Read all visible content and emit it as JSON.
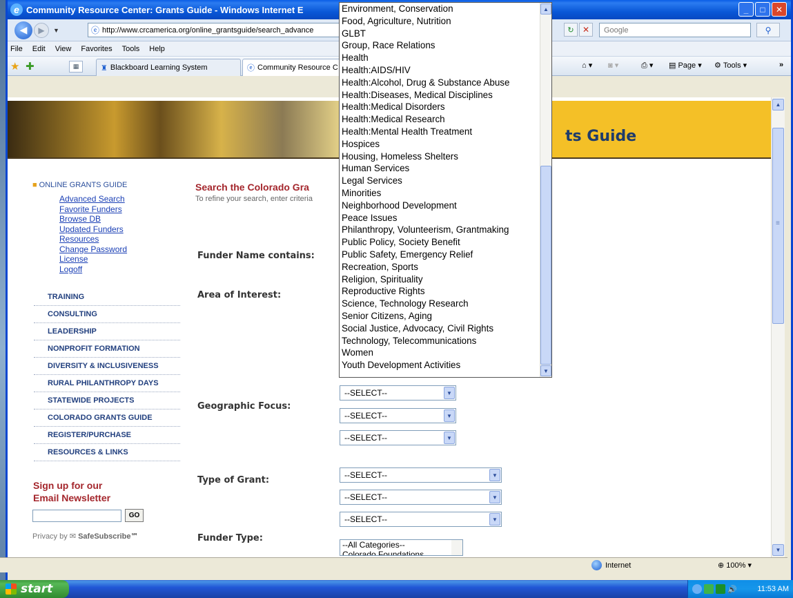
{
  "window": {
    "title": "Community Resource Center: Grants Guide - Windows Internet E",
    "minimize": "_",
    "maximize": "□",
    "close": "✕"
  },
  "address_bar": {
    "url": "http://www.crcamerica.org/online_grantsguide/search_advance",
    "search_placeholder": "Google"
  },
  "menu": [
    "File",
    "Edit",
    "View",
    "Favorites",
    "Tools",
    "Help"
  ],
  "tabs": [
    {
      "label": "Blackboard Learning System"
    },
    {
      "label": "Community Resource C"
    }
  ],
  "command_bar": {
    "page": "Page",
    "tools": "Tools"
  },
  "banner": {
    "title": "ts Guide"
  },
  "sidebar": {
    "heading": "ONLINE GRANTS GUIDE",
    "links": [
      "Advanced Search",
      "Favorite Funders",
      "Browse DB",
      "Updated Funders",
      "Resources",
      "Change Password",
      "License",
      "Logoff"
    ],
    "menu": [
      "TRAINING",
      "CONSULTING",
      "LEADERSHIP",
      "NONPROFIT FORMATION",
      "DIVERSITY & INCLUSIVENESS",
      "RURAL PHILANTHROPY DAYS",
      "STATEWIDE PROJECTS",
      "COLORADO GRANTS GUIDE",
      "REGISTER/PURCHASE",
      "RESOURCES & LINKS"
    ],
    "newsletter_line1": "Sign up for our",
    "newsletter_line2": "Email Newsletter",
    "go": "GO",
    "privacy_by": "Privacy by",
    "safesubscribe": "SafeSubscribe℠"
  },
  "search": {
    "title": "Search the Colorado Gra",
    "subtitle": "To refine your search, enter criteria",
    "labels": {
      "funder_name": "Funder Name contains:",
      "area": "Area of Interest:",
      "geo": "Geographic Focus:",
      "grant_type": "Type of Grant:",
      "funder_type": "Funder Type:"
    },
    "select_default": "--SELECT--",
    "funder_type_options": [
      "--All Categories--",
      "Colorado Foundations"
    ]
  },
  "area_dropdown_options": [
    "Environment, Conservation",
    "Food, Agriculture, Nutrition",
    "GLBT",
    "Group, Race Relations",
    "Health",
    "Health:AIDS/HIV",
    "Health:Alcohol, Drug & Substance Abuse",
    "Health:Diseases, Medical Disciplines",
    "Health:Medical Disorders",
    "Health:Medical Research",
    "Health:Mental Health Treatment",
    "Hospices",
    "Housing, Homeless Shelters",
    "Human Services",
    "Legal Services",
    "Minorities",
    "Neighborhood Development",
    "Peace Issues",
    "Philanthropy, Volunteerism, Grantmaking",
    "Public Policy, Society Benefit",
    "Public Safety, Emergency Relief",
    "Recreation, Sports",
    "Religion, Spirituality",
    "Reproductive Rights",
    "Science, Technology Research",
    "Senior Citizens, Aging",
    "Social Justice, Advocacy, Civil Rights",
    "Technology, Telecommunications",
    "Women",
    "Youth Development Activities"
  ],
  "status": {
    "zone": "Internet",
    "zoom": "100%"
  },
  "taskbar": {
    "start": "start",
    "clock": "11:53 AM"
  }
}
